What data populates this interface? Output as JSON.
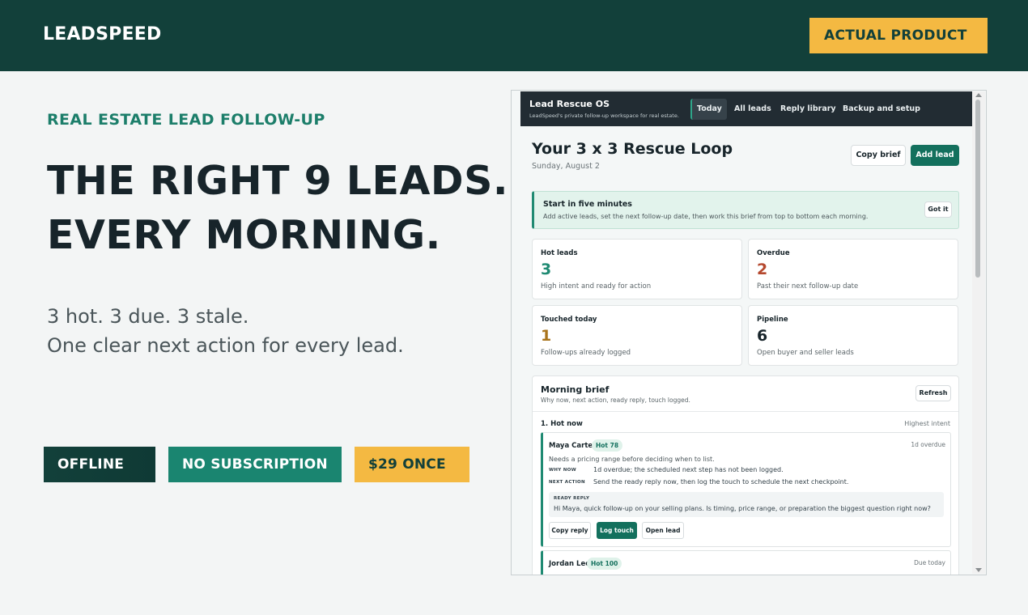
{
  "banner": {
    "brand": "LEADSPEED",
    "badge": "ACTUAL PRODUCT"
  },
  "hero": {
    "eyebrow": "REAL ESTATE LEAD FOLLOW-UP",
    "headline": [
      "THE RIGHT 9 LEADS.",
      "EVERY MORNING."
    ],
    "sub": [
      "3 hot. 3 due. 3 stale.",
      "One clear next action for every lead."
    ],
    "pills": {
      "offline": "OFFLINE",
      "no_subscription": "NO SUBSCRIPTION",
      "price": "$29 ONCE"
    }
  },
  "app": {
    "title": "Lead Rescue OS",
    "subtitle": "LeadSpeed's private follow-up workspace for real estate.",
    "nav": [
      "Today",
      "All leads",
      "Reply library",
      "Backup and setup"
    ],
    "active_nav": "Today",
    "page_title": "Your 3 x 3 Rescue Loop",
    "page_date": "Sunday, August 2",
    "buttons": {
      "copy_brief": "Copy brief",
      "add_lead": "Add lead"
    },
    "notice": {
      "title": "Start in five minutes",
      "text": "Add active leads, set the next follow-up date, then work this brief from top to bottom each morning.",
      "button": "Got it"
    },
    "stats": [
      {
        "label": "Hot leads",
        "value": "3",
        "desc": "High intent and ready for action",
        "color": "#1f8a72"
      },
      {
        "label": "Overdue",
        "value": "2",
        "desc": "Past their next follow-up date",
        "color": "#b5482e"
      },
      {
        "label": "Touched today",
        "value": "1",
        "desc": "Follow-ups already logged",
        "color": "#a9741c"
      },
      {
        "label": "Pipeline",
        "value": "6",
        "desc": "Open buyer and seller leads",
        "color": "#17242a"
      }
    ],
    "brief": {
      "title": "Morning brief",
      "subtitle": "Why now, next action, ready reply, touch logged.",
      "refresh": "Refresh",
      "section_title": "1. Hot now",
      "section_tag": "Highest intent",
      "leads": [
        {
          "name": "Maya Carter",
          "badge": "Hot 78",
          "status": "1d overdue",
          "summary": "Needs a pricing range before deciding when to list.",
          "why_now_label": "WHY NOW",
          "why_now": "1d overdue; the scheduled next step has not been logged.",
          "next_action_label": "NEXT ACTION",
          "next_action": "Send the ready reply now, then log the touch to schedule the next checkpoint.",
          "ready_reply_label": "READY REPLY",
          "ready_reply": "Hi Maya, quick follow-up on your selling plans. Is timing, price range, or preparation the biggest question right now?",
          "actions": [
            "Copy reply",
            "Log touch",
            "Open lead"
          ]
        },
        {
          "name": "Jordan Lee",
          "badge": "Hot 100",
          "status": "Due today"
        }
      ]
    }
  },
  "colors": {
    "banner": "#12403a",
    "accent_green": "#1a8570",
    "accent_gold": "#f4b942",
    "app_header": "#222c33"
  }
}
